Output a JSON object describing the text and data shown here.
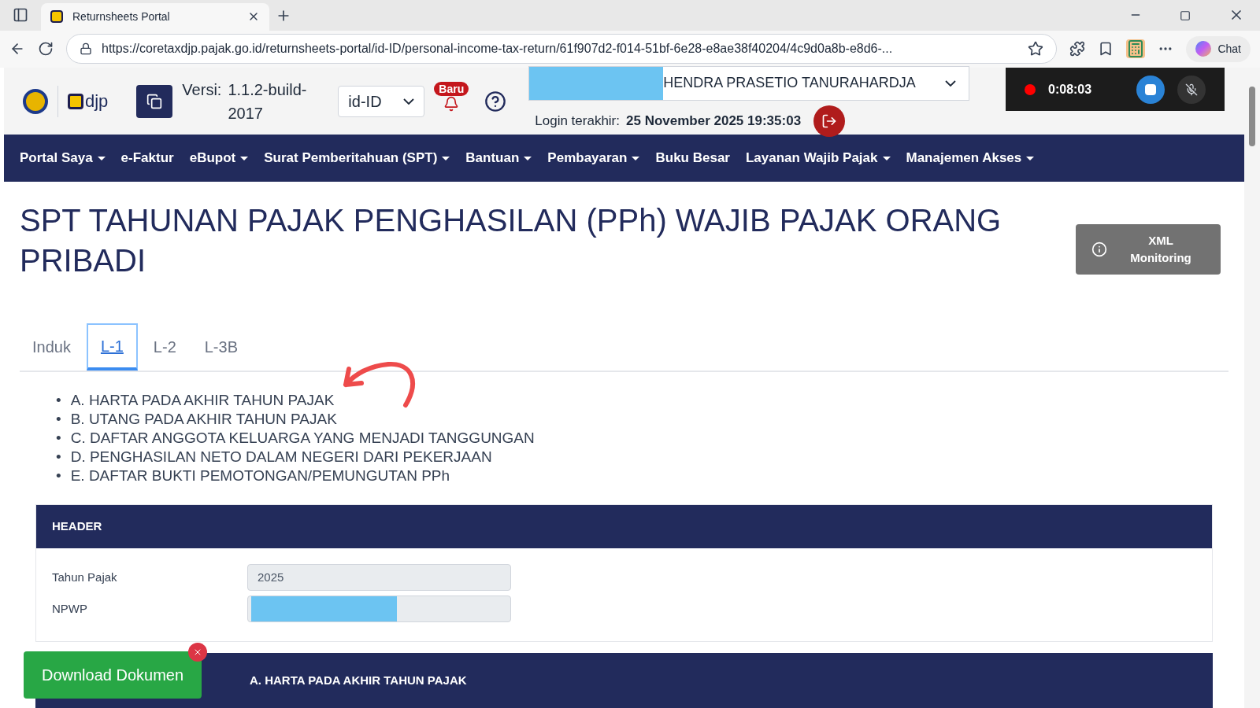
{
  "browser": {
    "tab_title": "Returnsheets Portal",
    "url": "https://coretaxdjp.pajak.go.id/returnsheets-portal/id-ID/personal-income-tax-return/61f907d2-f014-51bf-6e28-e8ae38f40204/4c9d0a8b-e8d6-...",
    "chat_label": "Chat"
  },
  "header": {
    "logo_text": "djp",
    "version_label": "Versi:",
    "version": "1.1.2-build-2017",
    "language": "id-ID",
    "badge": "Baru",
    "user_name": "HENDRA PRASETIO TANURAHARDJA",
    "login_label": "Login terakhir:",
    "login_time": "25 November 2025 19:35:03"
  },
  "recorder": {
    "time": "0:08:03"
  },
  "nav": [
    {
      "label": "Portal Saya",
      "dropdown": true
    },
    {
      "label": "e-Faktur",
      "dropdown": false
    },
    {
      "label": "eBupot",
      "dropdown": true
    },
    {
      "label": "Surat Pemberitahuan (SPT)",
      "dropdown": true
    },
    {
      "label": "Bantuan",
      "dropdown": true
    },
    {
      "label": "Pembayaran",
      "dropdown": true
    },
    {
      "label": "Buku Besar",
      "dropdown": false
    },
    {
      "label": "Layanan Wajib Pajak",
      "dropdown": true
    },
    {
      "label": "Manajemen Akses",
      "dropdown": true
    }
  ],
  "title": "SPT TAHUNAN PAJAK PENGHASILAN (PPh) WAJIB PAJAK ORANG PRIBADI",
  "xml_button": "XML Monitoring",
  "tabs": [
    {
      "label": "Induk",
      "selected": false
    },
    {
      "label": "L-1",
      "selected": true
    },
    {
      "label": "L-2",
      "selected": false
    },
    {
      "label": "L-3B",
      "selected": false
    }
  ],
  "sections_list": [
    {
      "marker": "•",
      "text": "A. HARTA PADA AKHIR TAHUN PAJAK"
    },
    {
      "marker": "•",
      "text": "B. UTANG PADA AKHIR TAHUN PAJAK"
    },
    {
      "marker": "•",
      "text": "C. DAFTAR ANGGOTA KELUARGA YANG MENJADI TANGGUNGAN"
    },
    {
      "marker": "•",
      "text": "D. PENGHASILAN NETO DALAM NEGERI DARI PEKERJAAN"
    },
    {
      "marker": "•",
      "text": "E. DAFTAR BUKTI PEMOTONGAN/PEMUNGUTAN PPh"
    }
  ],
  "header_card": {
    "title": "HEADER",
    "fields": [
      {
        "label": "Tahun Pajak",
        "kind": "text",
        "value": "2025"
      },
      {
        "label": "NPWP",
        "kind": "redacted"
      }
    ]
  },
  "next_section": "A. HARTA PADA AKHIR TAHUN PAJAK",
  "download_button": "Download Dokumen"
}
